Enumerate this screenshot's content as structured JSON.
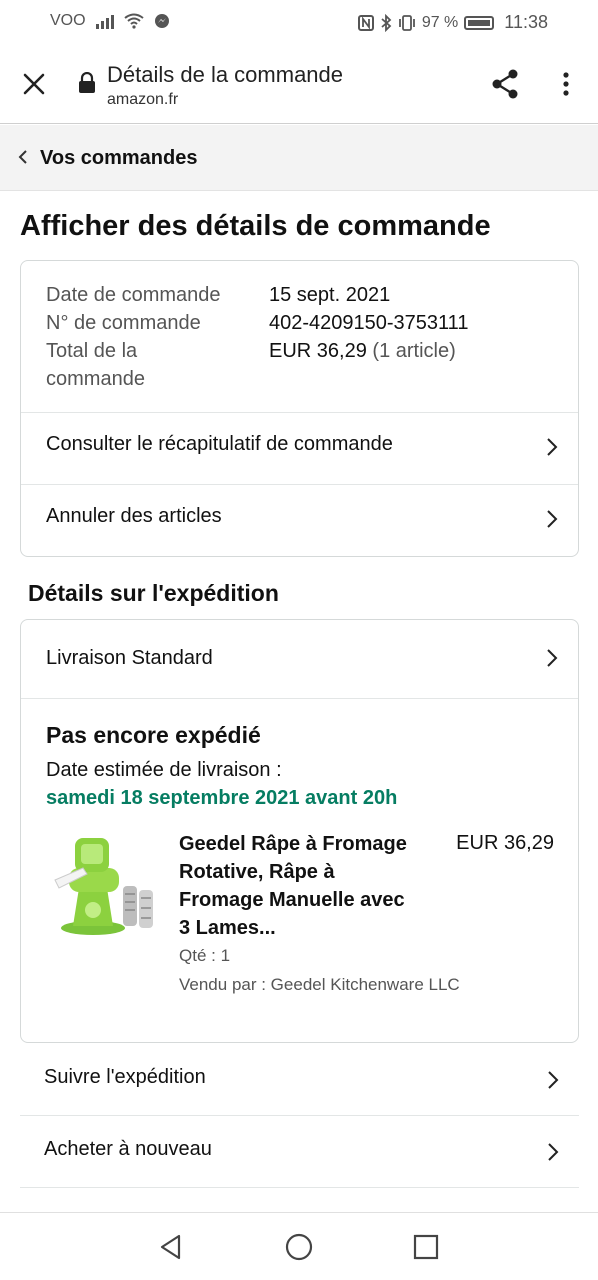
{
  "status_bar": {
    "carrier": "VOO",
    "battery": "97 %",
    "time": "11:38"
  },
  "custom_tab": {
    "title": "Détails de la commande",
    "url": "amazon.fr"
  },
  "breadcrumb": {
    "label": "Vos commandes"
  },
  "page_title": "Afficher des détails de commande",
  "order_summary": {
    "date_label": "Date de commande",
    "date_value": "15 sept. 2021",
    "number_label": "N° de commande",
    "number_value": "402-4209150-3753111",
    "total_label_line1": "Total de la",
    "total_label_line2": "commande",
    "total_value": "EUR 36,29",
    "total_items": "(1 article)",
    "actions": [
      {
        "label": "Consulter le récapitulatif de commande"
      },
      {
        "label": "Annuler des articles"
      }
    ]
  },
  "shipping": {
    "section_title": "Détails sur l'expédition",
    "method": "Livraison Standard",
    "status": "Pas encore expédié",
    "estimated_label": "Date estimée de livraison :",
    "estimated_date": "samedi 18 septembre 2021 avant 20h",
    "estimated_color": "#067d62",
    "product": {
      "name_lines": [
        "Geedel Râpe à Fromage",
        "Rotative, Râpe à",
        "Fromage Manuelle avec",
        "3 Lames..."
      ],
      "price": "EUR 36,29",
      "quantity": "Qté : 1",
      "seller": "Vendu par : Geedel Kitchenware LLC"
    }
  },
  "bottom_actions": [
    {
      "label": "Suivre l'expédition"
    },
    {
      "label": "Acheter à nouveau"
    }
  ]
}
